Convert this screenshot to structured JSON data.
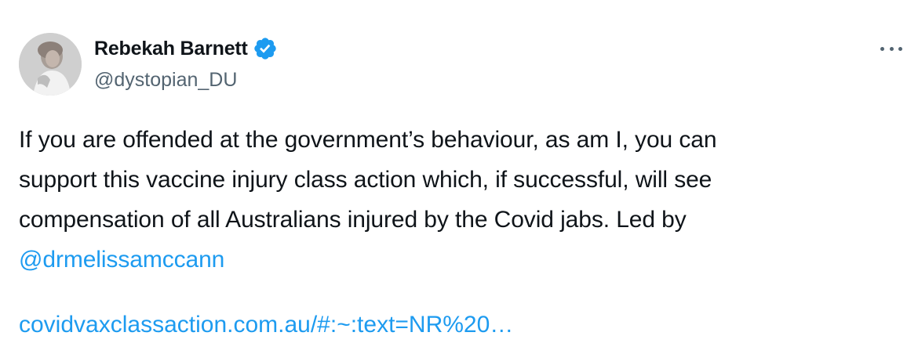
{
  "tweet": {
    "author": {
      "display_name": "Rebekah Barnett",
      "handle": "@dystopian_DU",
      "verified_icon": "verified-badge-icon",
      "avatar_icon": "profile-avatar"
    },
    "more_icon": "more-options-icon",
    "body": {
      "line1": "If you are offended at the government’s behaviour, as am I, you can",
      "line2": "support this vaccine injury class action which, if successful, will see",
      "line3": "compensation of all Australians injured by the Covid jabs. Led by",
      "mention": "@drmelissamccann",
      "url": "covidvaxclassaction.com.au/#:~:text=NR%20…"
    },
    "colors": {
      "text": "#0f1419",
      "secondary": "#536471",
      "link": "#1d9bf0",
      "verified": "#1d9bf0"
    }
  }
}
